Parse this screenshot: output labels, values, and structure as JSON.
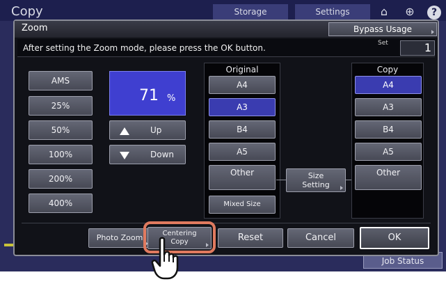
{
  "background": {
    "app_title": "Copy",
    "tabs": [
      "Storage",
      "Settings"
    ],
    "job_status": "Job Status",
    "icons": [
      "home-icon",
      "globe-icon",
      "help-icon"
    ]
  },
  "dialog": {
    "title": "Zoom",
    "bypass_label": "Bypass Usage",
    "message": "After setting the Zoom mode, please press the OK button.",
    "set_label": "Set",
    "set_value": "1"
  },
  "zoom": {
    "presets": [
      "AMS",
      "25%",
      "50%",
      "100%",
      "200%",
      "400%"
    ],
    "current_value": "71",
    "unit": "%",
    "up_label": "Up",
    "down_label": "Down"
  },
  "original": {
    "header": "Original",
    "sizes": [
      "A4",
      "A3",
      "B4",
      "A5",
      "Other",
      "Mixed Size"
    ],
    "selected": "A3"
  },
  "copy": {
    "header": "Copy",
    "sizes": [
      "A4",
      "A3",
      "B4",
      "A5",
      "Other"
    ],
    "selected": "A4"
  },
  "size_setting": {
    "line1": "Size",
    "line2": "Setting"
  },
  "bottom": {
    "photo_zoom": "Photo Zoom",
    "centering_line1": "Centering",
    "centering_line2": "Copy",
    "reset": "Reset",
    "cancel": "Cancel",
    "ok": "OK"
  },
  "colors": {
    "selected_blue": "#3a3cb0",
    "highlight": "#e07a5f"
  }
}
